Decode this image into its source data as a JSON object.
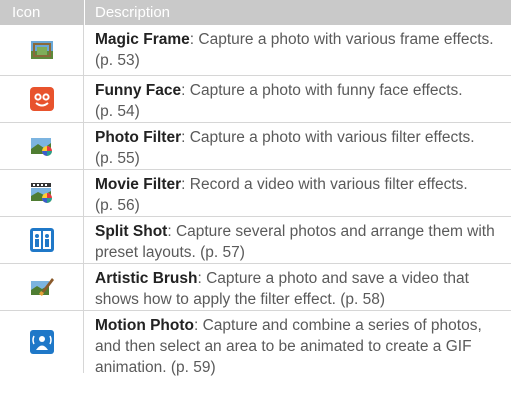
{
  "header": {
    "icon": "Icon",
    "description": "Description"
  },
  "rows": [
    {
      "icon": "magic-frame-icon",
      "title": "Magic Frame",
      "text": ": Capture a photo with various frame effects.",
      "ref": "(p. 53)"
    },
    {
      "icon": "funny-face-icon",
      "title": "Funny Face",
      "text": ": Capture a photo with funny face effects.",
      "ref": "(p. 54)"
    },
    {
      "icon": "photo-filter-icon",
      "title": "Photo Filter",
      "text": ": Capture a photo with various filter effects.",
      "ref": "(p. 55)"
    },
    {
      "icon": "movie-filter-icon",
      "title": "Movie Filter",
      "text": ": Record a video with various filter effects.",
      "ref": "(p. 56)"
    },
    {
      "icon": "split-shot-icon",
      "title": "Split Shot",
      "text": ": Capture several photos and arrange them with preset layouts. (p. 57)",
      "ref": ""
    },
    {
      "icon": "artistic-brush-icon",
      "title": "Artistic Brush",
      "text": ": Capture a photo and save a video that shows how to apply the filter effect. (p. 58)",
      "ref": ""
    },
    {
      "icon": "motion-photo-icon",
      "title": "Motion Photo",
      "text": ": Capture and combine a series of photos, and then select an area to be animated to create a GIF animation. (p. 59)",
      "ref": ""
    }
  ],
  "colors": {
    "header_bg": "#c9c9c9",
    "text": "#5a5a5a",
    "bold": "#222222",
    "rule": "#d6d6d6"
  }
}
